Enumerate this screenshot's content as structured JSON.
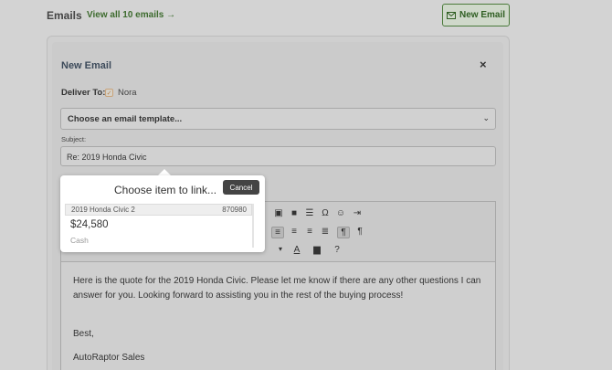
{
  "header": {
    "title": "Emails",
    "view_all": "View all 10 emails →",
    "new_email": "New Email",
    "new_email_icon": "envelope-icon"
  },
  "form": {
    "title": "New Email",
    "close": "×",
    "deliver_label": "Deliver To:",
    "deliver_name": "Nora",
    "deliver_checked": true,
    "template_placeholder": "Choose an email template...",
    "subject_label": "Subject:",
    "subject_value": "Re: 2019 Honda Civic"
  },
  "popover": {
    "title": "Choose item to link...",
    "cancel": "Cancel",
    "item": {
      "name": "2019 Honda Civic 2",
      "number": "870980",
      "price": "$24,580",
      "type": "Cash"
    }
  },
  "toolbar": {
    "icons": [
      "image-icon",
      "video-icon",
      "horizontal-rule-icon",
      "omega-icon",
      "emoji-icon",
      "indent-icon",
      "align-left-icon",
      "align-center-icon",
      "align-right-icon",
      "align-justify-icon",
      "ltr-icon",
      "rtl-icon",
      "font-color-icon",
      "background-color-icon",
      "help-icon"
    ]
  },
  "editor": {
    "line1": "Here is the quote for the 2019 Honda Civic. Please let me know if there are any other questions I can",
    "line2": "answer for you. Looking forward to assisting you in the rest of the buying process!",
    "line3": "Best,",
    "line4": "AutoRaptor Sales"
  },
  "colors": {
    "accent_green": "#3d6b2e",
    "background": "#d3d3d3"
  }
}
